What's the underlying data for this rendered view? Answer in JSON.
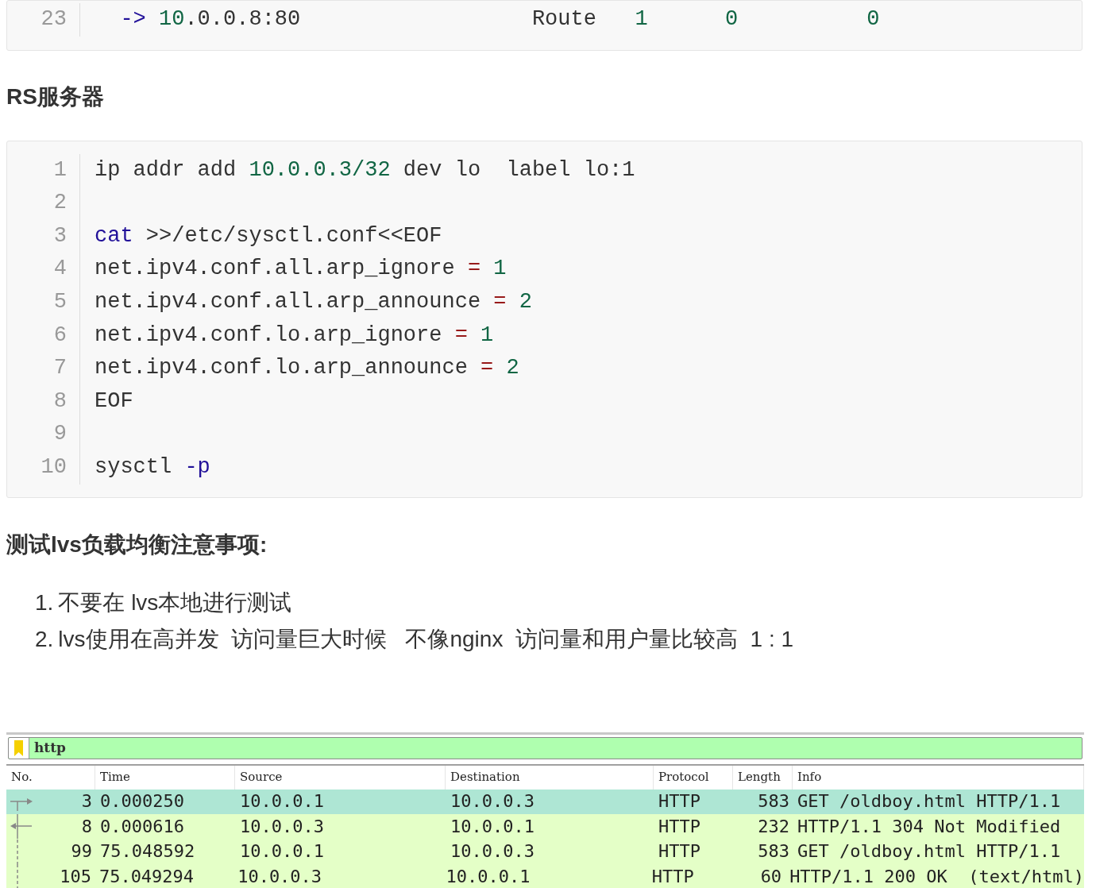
{
  "top_code_block": {
    "lines": [
      {
        "number": "23",
        "tokens": [
          {
            "text": "  ->",
            "kind": "keyword"
          },
          {
            "text": " 10",
            "kind": "number"
          },
          {
            "text": ".0.0.8:80                  Route   ",
            "kind": "plain"
          },
          {
            "text": "1      ",
            "kind": "number"
          },
          {
            "text": "0          ",
            "kind": "number"
          },
          {
            "text": "0",
            "kind": "number"
          }
        ]
      }
    ]
  },
  "rs_heading": "RS服务器",
  "rs_code_block": {
    "lines": [
      {
        "number": "1",
        "tokens": [
          {
            "text": "ip addr add ",
            "kind": "plain"
          },
          {
            "text": "10.0.0.3/32",
            "kind": "number"
          },
          {
            "text": " dev lo  label lo:1",
            "kind": "plain"
          }
        ]
      },
      {
        "number": "2"
      },
      {
        "number": "3",
        "tokens": [
          {
            "text": "cat",
            "kind": "keyword"
          },
          {
            "text": " >>/etc/sysctl.conf<<EOF",
            "kind": "plain"
          }
        ]
      },
      {
        "number": "4",
        "tokens": [
          {
            "text": "net.ipv4.conf.all.arp_ignore ",
            "kind": "plain"
          },
          {
            "text": "= ",
            "kind": "operator"
          },
          {
            "text": "1",
            "kind": "number"
          }
        ]
      },
      {
        "number": "5",
        "tokens": [
          {
            "text": "net.ipv4.conf.all.arp_announce ",
            "kind": "plain"
          },
          {
            "text": "= ",
            "kind": "operator"
          },
          {
            "text": "2",
            "kind": "number"
          }
        ]
      },
      {
        "number": "6",
        "tokens": [
          {
            "text": "net.ipv4.conf.lo.arp_ignore ",
            "kind": "plain"
          },
          {
            "text": "= ",
            "kind": "operator"
          },
          {
            "text": "1",
            "kind": "number"
          }
        ]
      },
      {
        "number": "7",
        "tokens": [
          {
            "text": "net.ipv4.conf.lo.arp_announce ",
            "kind": "plain"
          },
          {
            "text": "= ",
            "kind": "operator"
          },
          {
            "text": "2",
            "kind": "number"
          }
        ]
      },
      {
        "number": "8",
        "tokens": [
          {
            "text": "EOF",
            "kind": "plain"
          }
        ]
      },
      {
        "number": "9"
      },
      {
        "number": "10",
        "tokens": [
          {
            "text": "sysctl ",
            "kind": "plain"
          },
          {
            "text": "-p",
            "kind": "keyword"
          }
        ]
      }
    ]
  },
  "notes_heading": "测试lvs负载均衡注意事项:",
  "notes": [
    {
      "marker": "1.",
      "text": "不要在 lvs本地进行测试"
    },
    {
      "marker": "2.",
      "text": "lvs使用在高并发  访问量巨大时候   不像nginx  访问量和用户量比较高  1 : 1"
    }
  ],
  "packet_capture": {
    "filter": "http",
    "columns": [
      "No.",
      "Time",
      "Source",
      "Destination",
      "Protocol",
      "Length",
      "Info"
    ],
    "rows": [
      {
        "selected": true,
        "kind": "request",
        "cells": [
          "3",
          "0.000250",
          "10.0.0.1",
          "10.0.0.3",
          "HTTP",
          "583",
          "GET /oldboy.html HTTP/1.1"
        ]
      },
      {
        "selected": false,
        "kind": "response",
        "cells": [
          "8",
          "0.000616",
          "10.0.0.3",
          "10.0.0.1",
          "HTTP",
          "232",
          "HTTP/1.1 304 Not Modified"
        ]
      },
      {
        "selected": false,
        "kind": "related",
        "cells": [
          "99",
          "75.048592",
          "10.0.0.1",
          "10.0.0.3",
          "HTTP",
          "583",
          "GET /oldboy.html HTTP/1.1"
        ]
      },
      {
        "selected": false,
        "kind": "related",
        "cells": [
          "105",
          "75.049294",
          "10.0.0.3",
          "10.0.0.1",
          "HTTP",
          "60",
          "HTTP/1.1 200 OK  (text/html)"
        ]
      }
    ]
  }
}
